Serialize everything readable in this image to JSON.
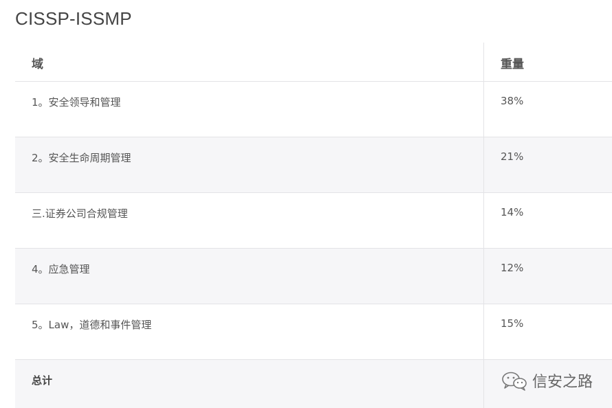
{
  "page": {
    "title": "CISSP-ISSMP"
  },
  "table": {
    "headers": {
      "domain": "域",
      "weight": "重量"
    },
    "rows": [
      {
        "domain": "1。安全领导和管理",
        "weight": "38%"
      },
      {
        "domain": "2。安全生命周期管理",
        "weight": "21%"
      },
      {
        "domain": "三.证券公司合规管理",
        "weight": "14%"
      },
      {
        "domain": "4。应急管理",
        "weight": "12%"
      },
      {
        "domain": "5。Law，道德和事件管理",
        "weight": "15%"
      }
    ],
    "total": {
      "label": "总计"
    }
  },
  "watermark": {
    "text": "信安之路",
    "icon": "wechat-icon"
  }
}
